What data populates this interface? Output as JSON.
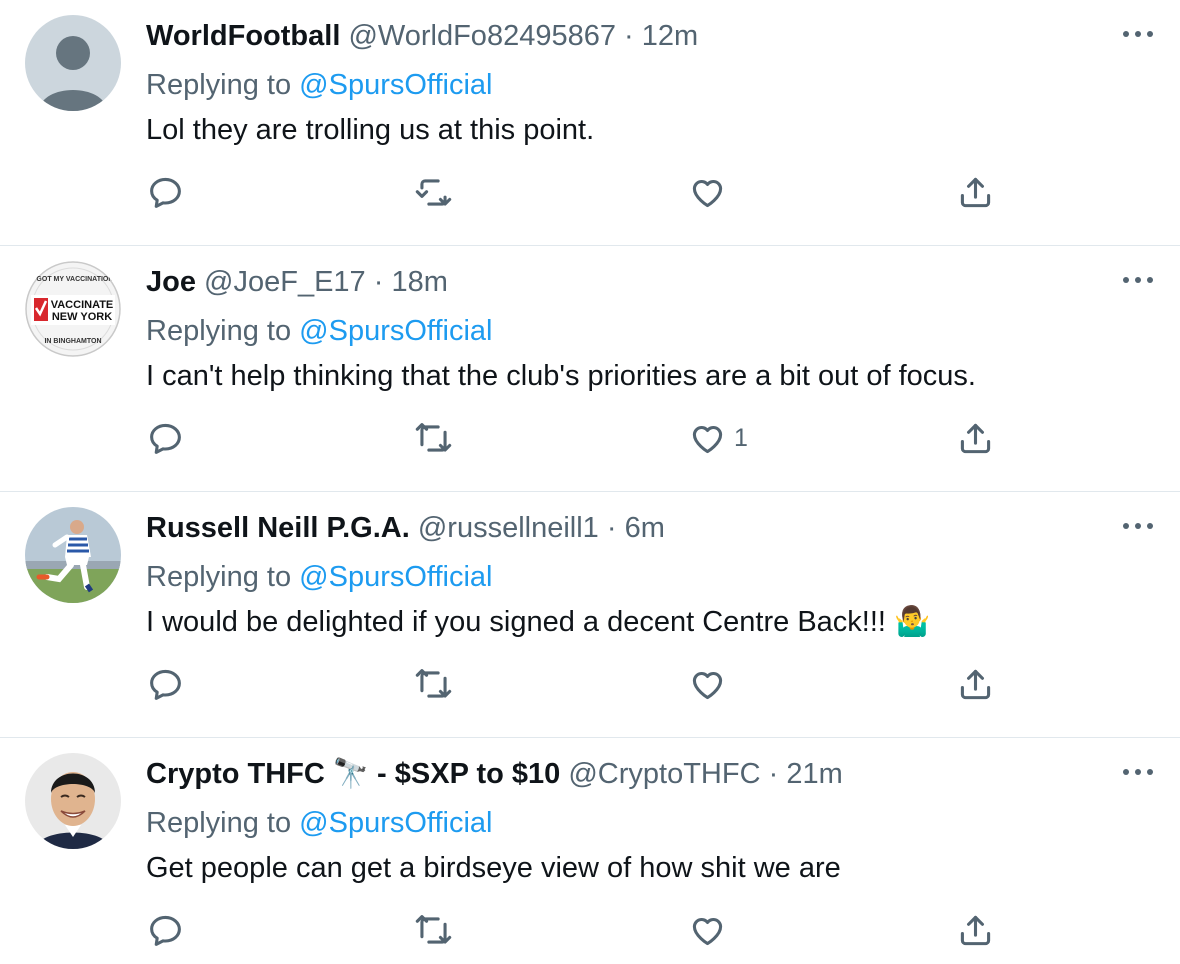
{
  "colors": {
    "link": "#1d9bf0",
    "secondary_text": "#536471",
    "primary_text": "#0f1419",
    "divider": "#e1e8ed"
  },
  "replying_label": "Replying to",
  "tweets": [
    {
      "name": "WorldFootball",
      "handle": "@WorldFo82495867",
      "separator": "·",
      "time": "12m",
      "reply_to": "@SpursOfficial",
      "text": "Lol they are trolling us at this point.",
      "like_count": "",
      "avatar": "default-avatar"
    },
    {
      "name": "Joe",
      "handle": "@JoeF_E17",
      "separator": "·",
      "time": "18m",
      "reply_to": "@SpursOfficial",
      "text": "I can't help thinking that the club's priorities are a bit out of focus.",
      "like_count": "1",
      "avatar": "vaccination-badge-avatar",
      "badge_top": "I GOT MY VACCINATION",
      "badge_mid_1": "VACCINATE",
      "badge_mid_2": "NEW YORK",
      "badge_bottom": "IN BINGHAMTON"
    },
    {
      "name": "Russell Neill P.G.A.",
      "handle": "@russellneill1",
      "separator": "·",
      "time": "6m",
      "reply_to": "@SpursOfficial",
      "text": "I would be delighted if you signed a decent Centre Back!!!",
      "emoji": "🤷‍♂️",
      "like_count": "",
      "avatar": "footballer-photo-avatar"
    },
    {
      "name": "Crypto THFC",
      "name_emoji": "🔭",
      "name_suffix": " - $SXP to $10",
      "handle": "@CryptoTHFC",
      "separator": "·",
      "time": "21m",
      "reply_to": "@SpursOfficial",
      "text": "Get people can get a birdseye view of how shit we are",
      "like_count": "",
      "avatar": "smiling-player-photo-avatar"
    }
  ]
}
